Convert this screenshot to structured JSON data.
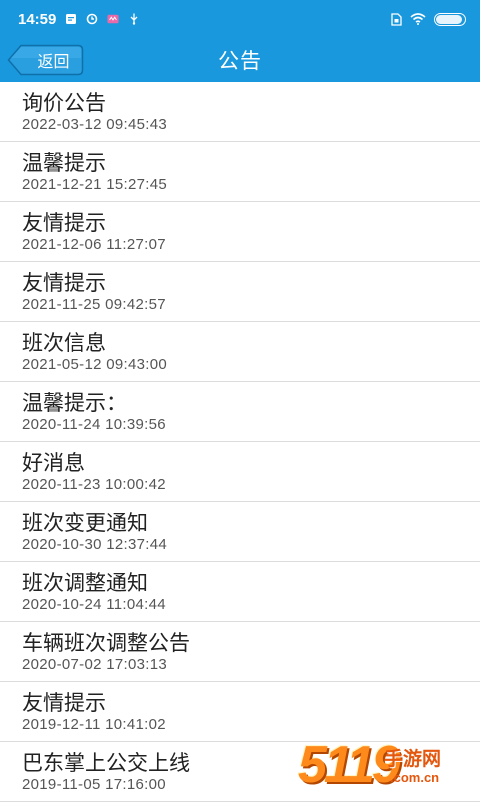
{
  "status_bar": {
    "time": "14:59",
    "left_icons": [
      "message-icon",
      "mail-icon",
      "sync-icon",
      "app-badge-icon",
      "usb-icon"
    ],
    "right_icons": [
      "sim-icon",
      "wifi-icon",
      "battery-icon"
    ],
    "battery_text": "",
    "battery_level": 0.9
  },
  "header": {
    "back_label": "返回",
    "title": "公告"
  },
  "notices": [
    {
      "title": "询价公告",
      "date": "2022-03-12 09:45:43"
    },
    {
      "title": "温馨提示",
      "date": "2021-12-21 15:27:45"
    },
    {
      "title": "友情提示",
      "date": "2021-12-06 11:27:07"
    },
    {
      "title": "友情提示",
      "date": "2021-11-25 09:42:57"
    },
    {
      "title": "班次信息",
      "date": "2021-05-12 09:43:00"
    },
    {
      "title": "温馨提示：",
      "date": "2020-11-24 10:39:56"
    },
    {
      "title": "好消息",
      "date": "2020-11-23 10:00:42"
    },
    {
      "title": "班次变更通知",
      "date": "2020-10-30 12:37:44"
    },
    {
      "title": "班次调整通知",
      "date": "2020-10-24 11:04:44"
    },
    {
      "title": "车辆班次调整公告",
      "date": "2020-07-02 17:03:13"
    },
    {
      "title": "友情提示",
      "date": "2019-12-11 10:41:02"
    },
    {
      "title": "巴东掌上公交上线",
      "date": "2019-11-05 17:16:00"
    }
  ],
  "watermark": {
    "number": "5119",
    "text": "手游网",
    "url": ".com.cn"
  },
  "colors": {
    "primary": "#1a98de",
    "watermark": "#ff8a1c"
  }
}
